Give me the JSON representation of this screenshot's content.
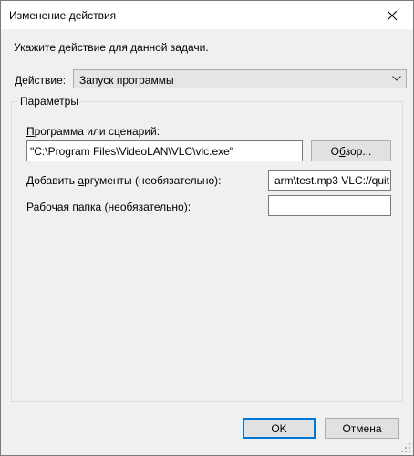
{
  "window": {
    "title": "Изменение действия"
  },
  "prompt": "Укажите действие для данной задачи.",
  "action": {
    "label": "Действие:",
    "selected": "Запуск программы"
  },
  "parameters": {
    "group_title": "Параметры",
    "program_label": "Программа или сценарий:",
    "program_value": "\"C:\\Program Files\\VideoLAN\\VLC\\vlc.exe\"",
    "browse_label": "Обзор...",
    "args_label": "Добавить аргументы (необязательно):",
    "args_value": "arm\\test.mp3 VLC://quit",
    "workdir_label": "Рабочая папка (необязательно):",
    "workdir_value": ""
  },
  "buttons": {
    "ok": "OK",
    "cancel": "Отмена"
  },
  "colors": {
    "dialog_bg": "#f0f0f0",
    "default_button_border": "#0078d7"
  },
  "icons": {
    "close": "close-icon",
    "dropdown": "chevron-down-icon",
    "resize": "resize-grip-icon"
  }
}
